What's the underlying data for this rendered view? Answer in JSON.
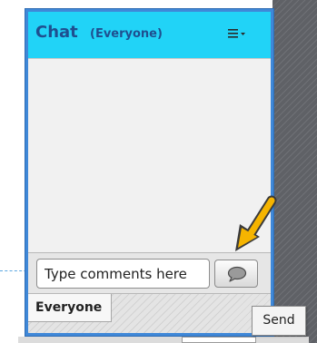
{
  "chat_pod": {
    "title": "Chat",
    "audience": "(Everyone)",
    "menu_icon": "hamburger-menu-icon",
    "input_placeholder": "Type comments here",
    "send_icon": "speech-bubble-icon",
    "tabs": [
      {
        "label": "Everyone",
        "selected": true
      }
    ]
  },
  "tooltip": {
    "text": "Send"
  },
  "annotation": {
    "icon": "pointer-arrow-icon",
    "color": "#f5b400"
  },
  "colors": {
    "header": "#21d3f7",
    "pod_border": "#3f88d8",
    "title_text": "#1f4f8f"
  }
}
